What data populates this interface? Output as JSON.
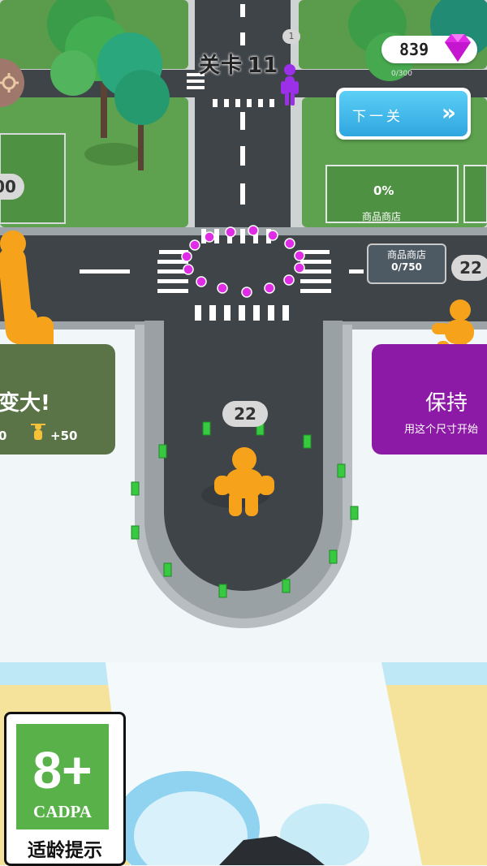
{
  "hud": {
    "level_label": "关卡",
    "level_number": "11",
    "small_indicator": "1",
    "gem_count": "839",
    "next_level_label": "下一关",
    "next_arrows": "»"
  },
  "world": {
    "crowd_count_badge": "22",
    "right_edge_badge": "22",
    "left_edge_badge": "00",
    "shop_store_label": "商品商店",
    "shop_store_progress": "0/750",
    "lot_percent": "0%",
    "lot_label": "商品商店",
    "far_lot_progress": "0/300"
  },
  "gates": {
    "left_title": "变大!",
    "left_value_a": "0",
    "left_value_b": "+50",
    "right_title": "保持",
    "right_subtitle": "用这个尺寸开始"
  },
  "age_rating": {
    "age": "8+",
    "org": "CADPA",
    "hint": "适龄提示"
  },
  "colors": {
    "road": "#3f4449",
    "grass": "#5ea24f",
    "player": "#f6a21a",
    "gem": "#e02ce6",
    "rival": "#9b30e8",
    "gate_green": "#5a7447",
    "gate_purple": "#8d1aa6",
    "button_blue": "#2fa6e0"
  },
  "icons": {
    "gem": "diamond-icon",
    "settings": "gear-icon",
    "next": "chevron-double-right-icon",
    "person": "person-icon"
  }
}
